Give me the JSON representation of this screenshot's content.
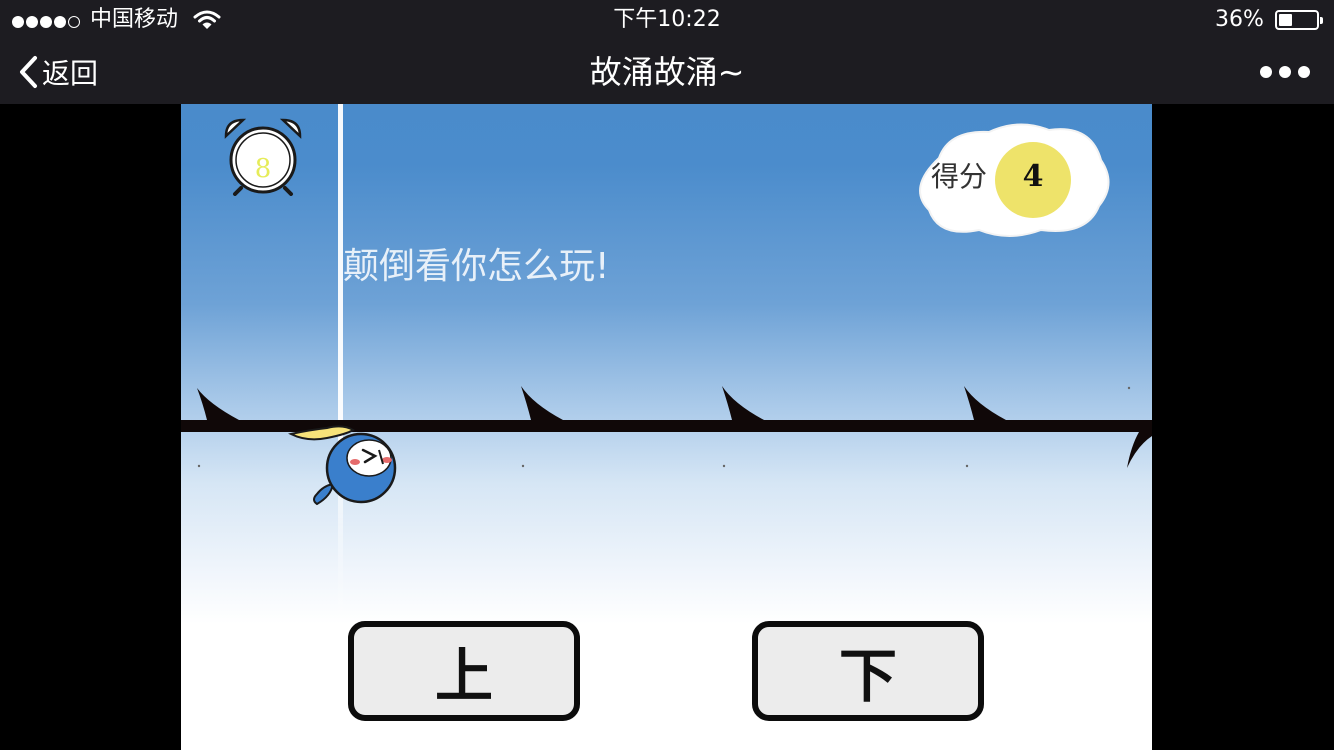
{
  "status_bar": {
    "carrier": "中国移动",
    "time": "下午10:22",
    "battery_percent_text": "36%",
    "battery_level": 0.36,
    "signal_bars_filled": 4,
    "signal_bars_total": 5
  },
  "nav": {
    "back_label": "返回",
    "title": "故涌故涌~",
    "more_icon": "ellipsis-icon"
  },
  "game": {
    "timer": "8",
    "score_label": "得分",
    "score_value": "4",
    "hint_text": "颠倒看你怎么玩!",
    "buttons": {
      "up_label": "上",
      "down_label": "下"
    }
  },
  "colors": {
    "bar_bg": "#1d1c21",
    "sky_top": "#4a8bcb",
    "score_badge": "#eee36a",
    "timer_digit": "#e6ec59",
    "bird_blue": "#3a7fcc"
  }
}
